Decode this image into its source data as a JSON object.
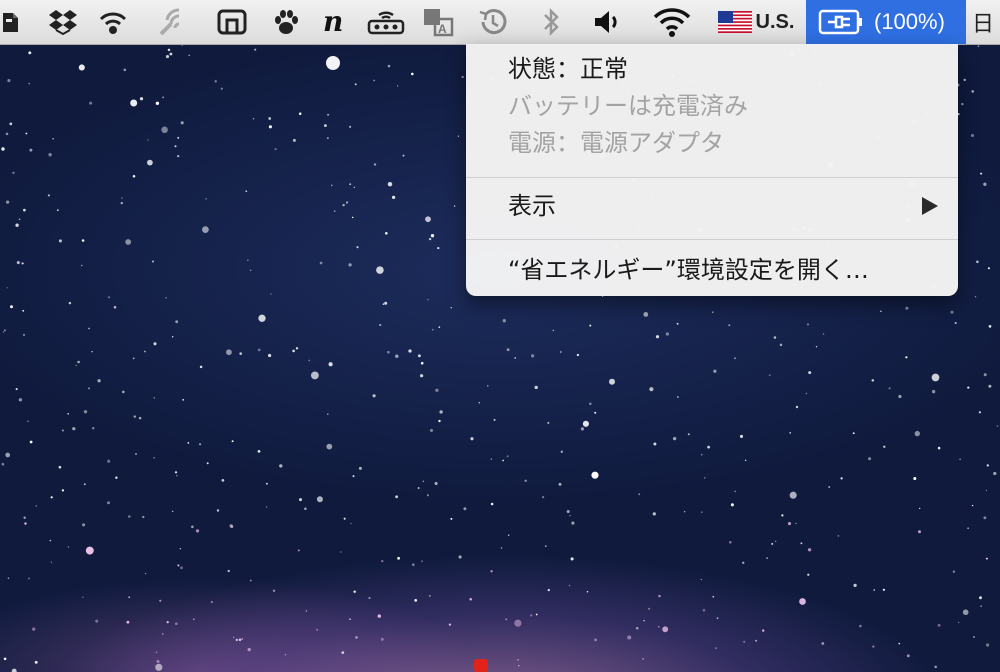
{
  "menubar": {
    "icons": [
      "evernote-icon",
      "dropbox-icon",
      "wifi-sync-icon",
      "satellite-icon",
      "window-icon",
      "paw-icon",
      "n-app-icon",
      "network-icon",
      "translate-icon",
      "time-machine-icon",
      "bluetooth-icon",
      "volume-icon",
      "wifi-icon"
    ],
    "input_source": {
      "flag": "us-flag-icon",
      "label": "U.S."
    },
    "battery": {
      "icon": "power-adapter-icon",
      "percent": "(100%)",
      "accent_color": "#2f6fe2"
    },
    "day": "日"
  },
  "battery_menu": {
    "status": "状態：正常",
    "charge_state": "バッテリーは充電済み",
    "power_source": "電源：電源アダプタ",
    "show_label": "表示",
    "open_prefs": "“省エネルギー”環境設定を開く…"
  }
}
